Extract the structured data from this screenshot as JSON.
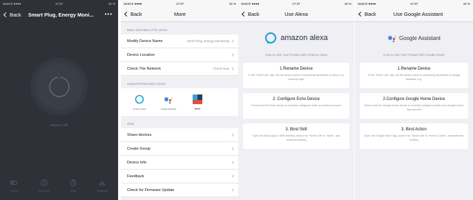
{
  "status": {
    "carrier": "Search",
    "signal": "●●●●",
    "time": "17:37",
    "battery": "15 %"
  },
  "phone1": {
    "back_label": "Back",
    "title": "Smart Plug, Energy Moni...",
    "more": "•••",
    "device_status": "Device is off",
    "bottom_items": [
      {
        "icon": "switch-icon",
        "label": "Switch"
      },
      {
        "icon": "schedule-icon",
        "label": "Schedule"
      },
      {
        "icon": "timer-icon",
        "label": "Timer"
      },
      {
        "icon": "statistics-icon",
        "label": "Statistics"
      }
    ]
  },
  "phone2": {
    "back_label": "Back",
    "title": "More",
    "basic_header": "Basic information of the device",
    "rows_basic": [
      {
        "label": "Modify Device Name",
        "value": "Smart Plug, Energy Monitoring"
      },
      {
        "label": "Device Location",
        "value": ""
      },
      {
        "label": "Check The Network",
        "value": "Check Now"
      }
    ],
    "third_party_header": "Supported third-party Control",
    "third_party": [
      {
        "icon": "amazon-alexa-icon",
        "label": "amazon alexa"
      },
      {
        "icon": "google-assistant-icon",
        "label": "Google Assistant"
      },
      {
        "icon": "ifttt-icon",
        "label": "IFTTT"
      }
    ],
    "other_header": "Other",
    "rows_other": [
      {
        "label": "Share devices"
      },
      {
        "label": "Create Group"
      },
      {
        "label": "Device Info"
      },
      {
        "label": "Feedback"
      },
      {
        "label": "Check for Firmware Update"
      }
    ]
  },
  "phone3": {
    "back_label": "Back",
    "title": "Use Alexa",
    "brand": "amazon alexa",
    "howto": "How to Link Your Product with Amazon Alexa",
    "cards": [
      {
        "title": "1.Rename Device",
        "text": "In the \"Smart Life\" app, set the device name to something identifiable to Alexa, e.g. bedroom light"
      },
      {
        "title": "2. Configure Echo Device",
        "text": "Ensure that the Echo device is correctly configured under your Alexa account"
      },
      {
        "title": "3. Bind Skill",
        "text": "Open the Alexa App or Web terminal, search for \"Smart Life\" in \"Skills\", and authorize binding"
      }
    ],
    "accent": "#1da1d8"
  },
  "phone4": {
    "back_label": "Back",
    "title": "Use Google Assistant",
    "brand": "Google Assistant",
    "howto": "How to Link Your Product with Google Home",
    "cards": [
      {
        "title": "1.Rename Device",
        "text": "In the \"Smart Life\" app, set the device name to something identifiable to Google Assistant, e.g."
      },
      {
        "title": "2.Configure Google Home Device",
        "text": "Ensure that the Google Home device is correctly configured under your Google Home App account"
      },
      {
        "title": "3. Bind Action",
        "text": "Open the Google Home App, search for \"Smart Life\" in \"Home Control\", and authorize binding"
      }
    ]
  }
}
